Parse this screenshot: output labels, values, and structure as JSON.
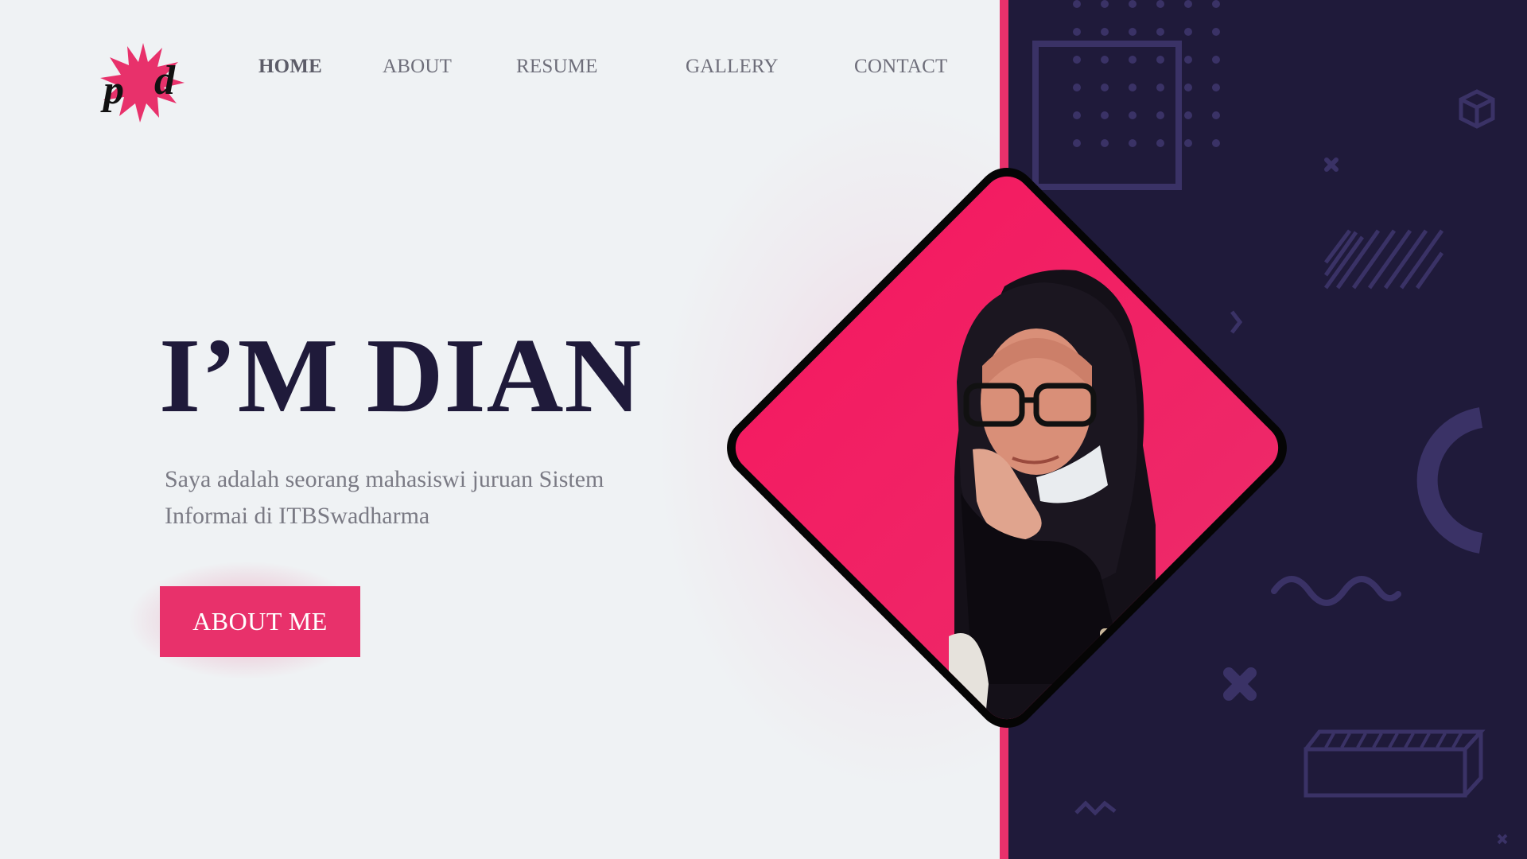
{
  "brand": {
    "logo_letters": "pd",
    "accent": "#e8316b",
    "dark": "#1f1a3a",
    "background": "#eff2f4"
  },
  "nav": {
    "items": [
      {
        "label": "HOME",
        "active": true
      },
      {
        "label": "ABOUT",
        "active": false
      },
      {
        "label": "RESUME",
        "active": false
      },
      {
        "label": "GALLERY",
        "active": false
      },
      {
        "label": "CONTACT",
        "active": false
      }
    ]
  },
  "hero": {
    "title": "I’M DIAN",
    "subtitle_line1": "Saya adalah seorang mahasiswi juruan Sistem",
    "subtitle_line2": "Informai di ITBSwadharma",
    "cta_label": "ABOUT ME"
  },
  "photo": {
    "icon": "portrait-photo"
  }
}
